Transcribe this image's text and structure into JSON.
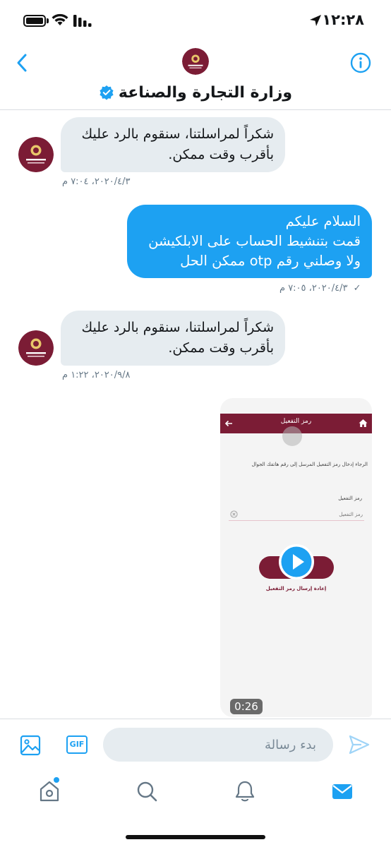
{
  "status_bar": {
    "time": "١٢:٢٨",
    "icons": [
      "location-arrow-icon",
      "signal-bars-icon",
      "wifi-icon",
      "battery-icon"
    ]
  },
  "header": {
    "title": "وزارة التجارة والصناعة",
    "verified": true,
    "back_icon": "chevron-left-icon",
    "info_icon": "info-icon",
    "avatar": "ministry-logo"
  },
  "messages": [
    {
      "direction": "incoming",
      "lines": [
        "شكراً لمراسلتنا، سنقوم بالرد عليك",
        "بأقرب وقت ممكن."
      ],
      "timestamp": "٢٠٢٠/٤/٣، ٧:٠٤ م"
    },
    {
      "direction": "outgoing",
      "lines": [
        "السلام عليكم",
        "قمت بتنشيط الحساب على الابلكيشن",
        "ولا وصلني رقم otp ممكن الحل"
      ],
      "timestamp": "٢٠٢٠/٤/٣، ٧:٠٥ م",
      "status": "✓"
    },
    {
      "direction": "incoming",
      "lines": [
        "شكراً لمراسلتنا، سنقوم بالرد عليك",
        "بأقرب وقت ممكن."
      ],
      "timestamp": "٢٠٢٠/٩/٨، ١:٢٢ م"
    }
  ],
  "video": {
    "duration": "0:26",
    "screen": {
      "bar_title": "رمز التفعيل",
      "instruction": "الرجاء إدخال رمز التفعيل المرسل إلى رقم هاتفك الجوال",
      "field_label": "رمز التفعيل",
      "field_placeholder": "رمز التفعيل",
      "resend_label": "إعادة إرسال رمز التفعيل",
      "brand_color": "#7b1c35"
    }
  },
  "composer": {
    "placeholder": "بدء رسالة",
    "value": "",
    "gif_label": "GIF"
  },
  "tabbar": {
    "tabs": [
      "home-icon",
      "search-icon",
      "notifications-icon",
      "messages-icon"
    ],
    "active": "messages-icon",
    "home_has_notification_dot": true
  },
  "colors": {
    "accent": "#1da1f2",
    "incoming_bubble": "#e6ecf0",
    "brand": "#7b1c35"
  }
}
